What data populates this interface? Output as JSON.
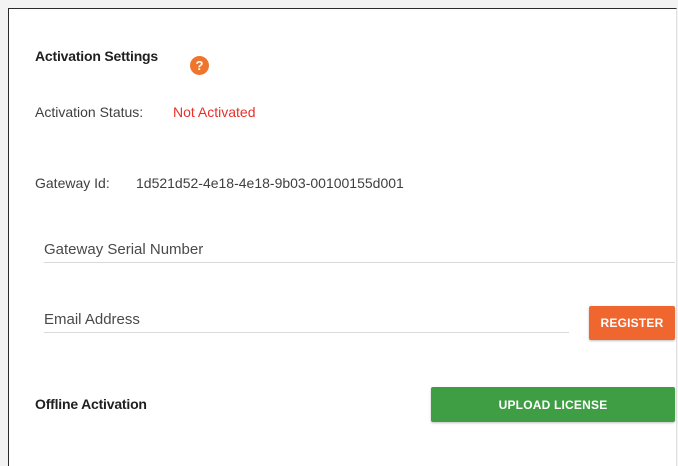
{
  "activation": {
    "title": "Activation Settings",
    "help_icon": "?",
    "status_label": "Activation Status:",
    "status_value": "Not Activated",
    "status_color": "#e8302c",
    "gateway_label": "Gateway Id:",
    "gateway_value": "1d521d52-4e18-4e18-9b03-00100155d001",
    "serial_placeholder": "Gateway Serial Number",
    "email_placeholder": "Email Address",
    "register_label": "REGISTER",
    "register_color": "#f0662f",
    "offline_label": "Offline Activation",
    "upload_label": "UPLOAD LICENSE",
    "upload_color": "#3f9e44"
  }
}
